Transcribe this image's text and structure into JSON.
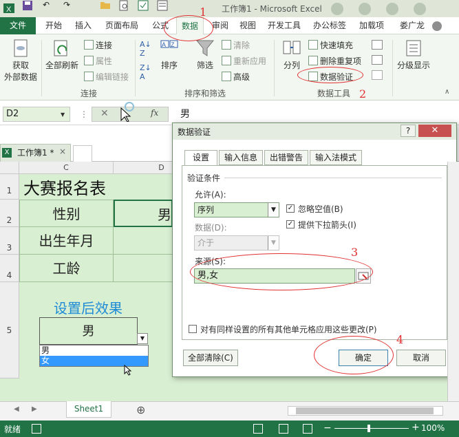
{
  "window": {
    "title": "工作簿1 - Microsoft Excel"
  },
  "ribbon": {
    "file_tab": "文件",
    "tabs": [
      "开始",
      "插入",
      "页面布局",
      "公式",
      "数据",
      "审阅",
      "视图",
      "开发工具",
      "办公标签",
      "加载项"
    ],
    "active_tab": "数据",
    "user": "娄广龙",
    "get_external_line1": "获取",
    "get_external_line2": "外部数据",
    "refresh_all": "全部刷新",
    "connections": "连接",
    "properties": "属性",
    "edit_links": "编辑链接",
    "group_connections": "连接",
    "sort": "排序",
    "filter": "筛选",
    "clear": "清除",
    "reapply": "重新应用",
    "advanced": "高级",
    "group_sort_filter": "排序和筛选",
    "split": "分列",
    "flash_fill": "快速填充",
    "remove_duplicates": "删除重复项",
    "data_validation": "数据验证",
    "group_data_tools": "数据工具",
    "outline": "分级显示"
  },
  "formula_bar": {
    "name_box": "D2",
    "value": "男",
    "fx": "fx",
    "cancel": "✕"
  },
  "workbook_tab": {
    "label": "工作簿1 *"
  },
  "grid": {
    "col_c": "C",
    "col_d": "D",
    "rows": [
      "1",
      "2",
      "3",
      "4",
      "5"
    ],
    "title": "大赛报名表",
    "label_gender": "性别",
    "value_gender": "男",
    "label_birth": "出生年月",
    "label_work_years": "工龄",
    "effect_heading": "设置后效果",
    "demo_value": "男",
    "dropdown_options": [
      "男",
      "女"
    ]
  },
  "dialog": {
    "title": "数据验证",
    "help": "?",
    "close": "✕",
    "tabs": [
      "设置",
      "输入信息",
      "出错警告",
      "输入法模式"
    ],
    "section": "验证条件",
    "allow_label": "允许(A):",
    "allow_value": "序列",
    "data_label": "数据(D):",
    "data_value": "介于",
    "ignore_blank": "忽略空值(B)",
    "in_cell_dropdown": "提供下拉箭头(I)",
    "source_label": "来源(S):",
    "source_value": "男,女",
    "apply_all": "对有同样设置的所有其他单元格应用这些更改(P)",
    "clear_all": "全部清除(C)",
    "ok": "确定",
    "cancel": "取消"
  },
  "annotations": [
    "1",
    "2",
    "3",
    "4"
  ],
  "sheet_tabs": {
    "sheet1": "Sheet1",
    "add": "⊕"
  },
  "status": {
    "ready": "就绪",
    "zoom": "100%"
  },
  "colors": {
    "excel_green": "#217346",
    "annotation_red": "#e03030",
    "cell_green": "#d9efd2"
  }
}
